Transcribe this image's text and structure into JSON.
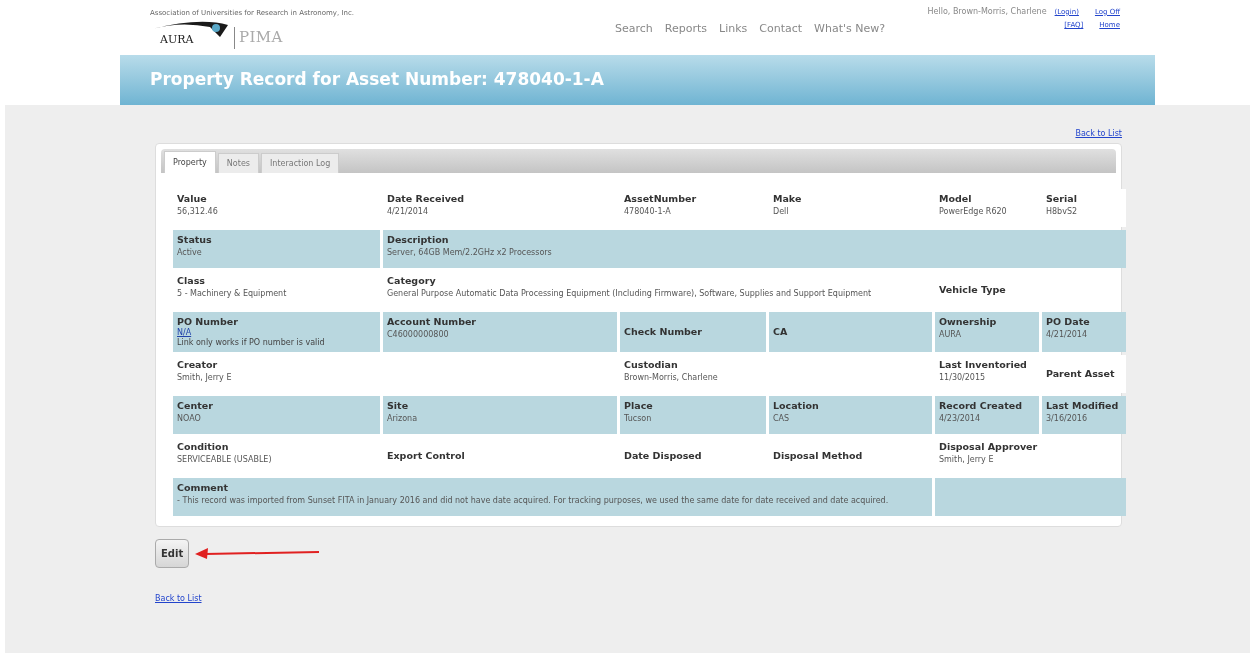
{
  "header": {
    "org": "Association of Universities for Research in Astronomy, Inc.",
    "logo_left": "AURA",
    "logo_right": "PIMA",
    "nav": [
      "Search",
      "Reports",
      "Links",
      "Contact",
      "What's New?"
    ],
    "greeting": "Hello, Brown-Morris, Charlene",
    "user_links": [
      "(Login)",
      "Log Off",
      "[FAQ]",
      "Home"
    ]
  },
  "banner": {
    "title": "Property Record for Asset Number: 478040-1-A"
  },
  "back_link_top": "Back to List",
  "tabs": [
    {
      "label": "Property",
      "selected": true
    },
    {
      "label": "Notes",
      "selected": false
    },
    {
      "label": "Interaction Log",
      "selected": false
    }
  ],
  "rows": [
    {
      "cells": [
        {
          "label": "Value",
          "value": "56,312.46"
        },
        {
          "label": "Date Received",
          "value": "4/21/2014"
        },
        {
          "label": "AssetNumber",
          "value": "478040-1-A"
        },
        {
          "label": "Make",
          "value": "Dell"
        },
        {
          "label": "Model",
          "value": "PowerEdge R620"
        },
        {
          "label": "Serial",
          "value": "H8bvS2"
        }
      ]
    },
    {
      "cells": [
        {
          "label": "Status",
          "value": "Active"
        },
        {
          "label": "Description",
          "value": "Server, 64GB Mem/2.2GHz x2 Processors"
        }
      ]
    },
    {
      "cells": [
        {
          "label": "Class",
          "value": "5 - Machinery & Equipment"
        },
        {
          "label": "Category",
          "value": "General Purpose Automatic Data Processing Equipment (Including Firmware), Software, Supplies and Support Equipment"
        },
        {
          "label": "Vehicle Type"
        }
      ]
    },
    {
      "cells": [
        {
          "label": "PO Number",
          "link": "N/A",
          "note": "Link only works if PO number is valid"
        },
        {
          "label": "Account Number",
          "value": "C46000000800"
        },
        {
          "label": "Check Number"
        },
        {
          "label": "CA"
        },
        {
          "label": "Ownership",
          "value": "AURA"
        },
        {
          "label": "PO Date",
          "value": "4/21/2014"
        }
      ]
    },
    {
      "cells": [
        {
          "label": "Creator",
          "value": "Smith, Jerry E"
        },
        {
          "label": "Custodian",
          "value": "Brown-Morris, Charlene"
        },
        {
          "label": "Last Inventoried",
          "value": "11/30/2015"
        },
        {
          "label": "Parent Asset"
        }
      ]
    },
    {
      "cells": [
        {
          "label": "Center",
          "value": "NOAO"
        },
        {
          "label": "Site",
          "value": "Arizona"
        },
        {
          "label": "Place",
          "value": "Tucson"
        },
        {
          "label": "Location",
          "value": "CAS"
        },
        {
          "label": "Record Created",
          "value": "4/23/2014"
        },
        {
          "label": "Last Modified",
          "value": "3/16/2016"
        }
      ]
    },
    {
      "cells": [
        {
          "label": "Condition",
          "value": "SERVICEABLE (USABLE)"
        },
        {
          "label": "Export Control"
        },
        {
          "label": "Date Disposed"
        },
        {
          "label": "Disposal Method"
        },
        {
          "label": "Disposal Approver",
          "value": "Smith, Jerry E"
        }
      ]
    },
    {
      "cells": [
        {
          "label": "Comment",
          "value": "- This record was imported from Sunset FITA in January 2016 and did not have date acquired. For tracking purposes, we used the same date for date received and date acquired."
        }
      ]
    }
  ],
  "edit_button": "Edit",
  "back_link_bottom": "Back to List"
}
